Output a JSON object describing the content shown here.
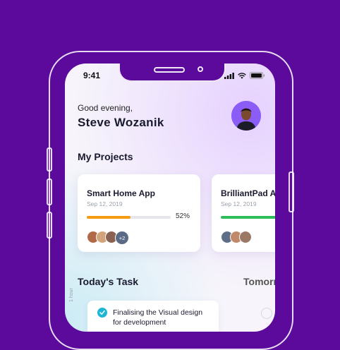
{
  "status_bar": {
    "time": "9:41"
  },
  "header": {
    "greeting": "Good evening,",
    "user_name": "Steve Wozanik"
  },
  "projects": {
    "title": "My Projects",
    "cards": [
      {
        "name": "Smart Home App",
        "date": "Sep 12, 2019",
        "progress": 0.52,
        "progress_label": "52%",
        "bar_color": "#f39c12",
        "more_members": "+2"
      },
      {
        "name": "BrilliantPad App",
        "date": "Sep 12, 2019",
        "bar_color": "#2dbd5b"
      }
    ]
  },
  "tasks": {
    "title": "Today's Task",
    "tomorrow_title": "Tomorrow",
    "hour_label": "1 hour",
    "items": [
      {
        "text": "Finalising the Visual design for development"
      }
    ]
  },
  "colors": {
    "background": "#5b0a9c",
    "accent": "#8b5cf6",
    "check": "#1fb6d6"
  }
}
